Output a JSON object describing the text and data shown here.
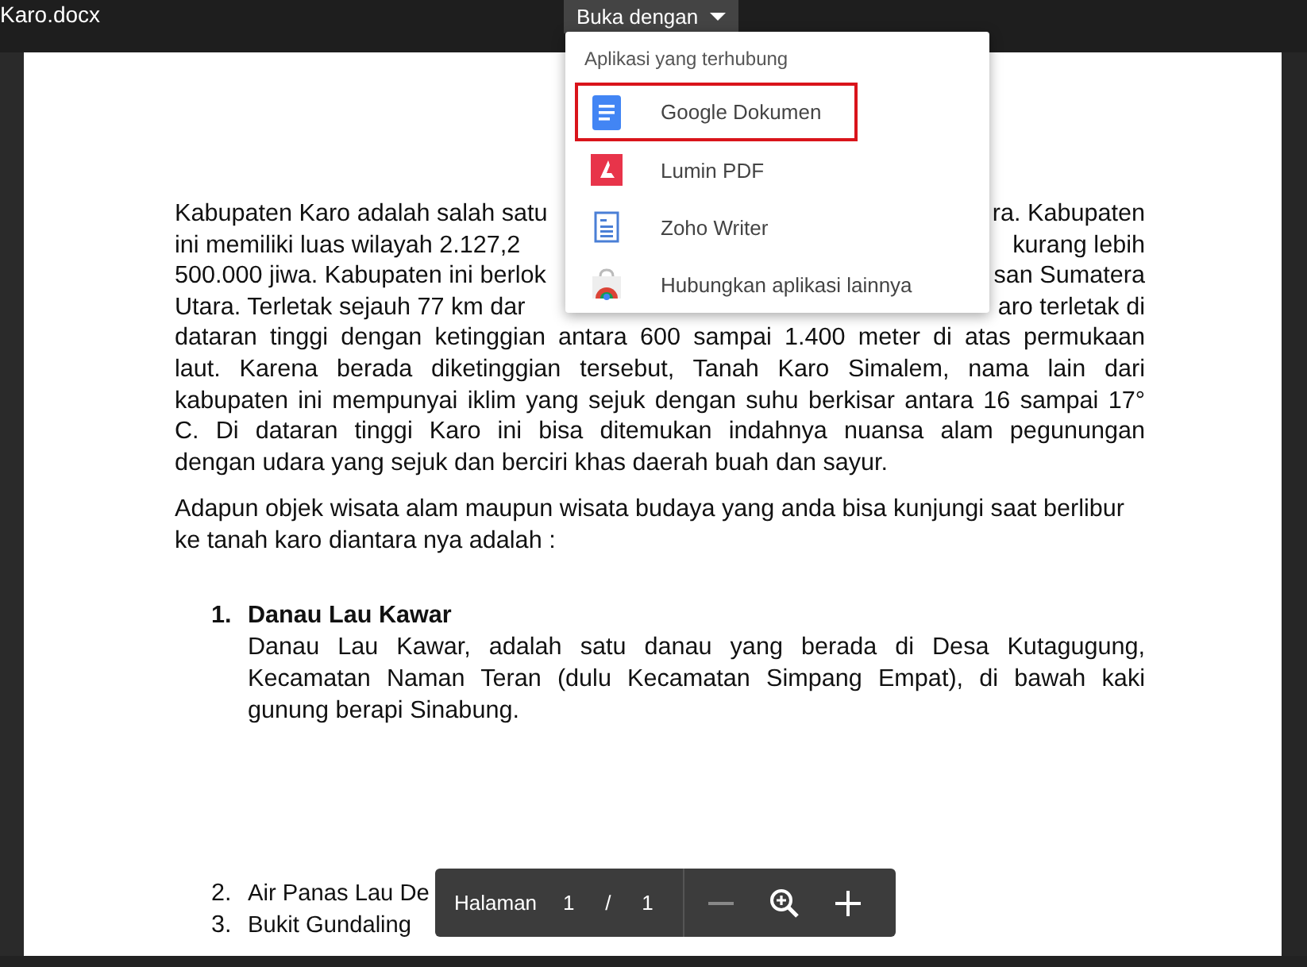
{
  "top_bar": {
    "file_name": "Karo.docx",
    "open_with": {
      "label": "Buka dengan",
      "expanded": true
    }
  },
  "open_with_menu": {
    "heading": "Aplikasi yang terhubung",
    "items": [
      {
        "label": "Google Dokumen",
        "kind": "docs",
        "selected": true
      },
      {
        "label": "Lumin PDF",
        "kind": "lumin",
        "selected": false
      },
      {
        "label": "Zoho Writer",
        "kind": "zoho",
        "selected": false
      },
      {
        "label": "Hubungkan aplikasi lainnya",
        "kind": "store",
        "selected": false
      }
    ]
  },
  "document": {
    "paragraph_1": [
      {
        "left": "Kabupaten Karo adalah salah satu",
        "right": "ra. Kabupaten"
      },
      {
        "left": "ini memiliki luas wilayah 2.127,2",
        "right": "kurang lebih"
      },
      {
        "left": "500.000 jiwa. Kabupaten ini berlok",
        "right": "san Sumatera"
      },
      {
        "left": "Utara. Terletak sejauh 77 km dar",
        "right": "aro terletak di"
      },
      {
        "text": "dataran tinggi dengan ketinggian antara 600 sampai 1.400 meter di atas permukaan"
      },
      {
        "text": "laut. Karena berada diketinggian tersebut, Tanah Karo Simalem, nama lain dari"
      },
      {
        "text": "kabupaten ini mempunyai iklim yang sejuk dengan suhu berkisar antara 16 sampai 17°"
      },
      {
        "text": "C. Di dataran tinggi Karo ini bisa ditemukan indahnya nuansa alam pegunungan"
      },
      {
        "text": "dengan udara yang sejuk dan berciri khas daerah buah dan sayur.",
        "last": true
      }
    ],
    "paragraph_2": "Adapun objek wisata alam maupun wisata budaya yang anda bisa kunjungi saat berlibur ke tanah karo diantara nya adalah :",
    "list": [
      {
        "number": "1.",
        "title": "Danau Lau Kawar",
        "body": "Danau Lau Kawar, adalah satu danau yang berada di Desa Kutagugung, Kecamatan Naman Teran (dulu Kecamatan Simpang Empat), di bawah kaki gunung berapi Sinabung."
      },
      {
        "number": "2.",
        "text": "Air Panas Lau De"
      },
      {
        "number": "3.",
        "text": "Bukit Gundaling"
      }
    ]
  },
  "page_toolbar": {
    "label": "Halaman",
    "current_page": "1",
    "separator": "/",
    "total_pages": "1"
  }
}
